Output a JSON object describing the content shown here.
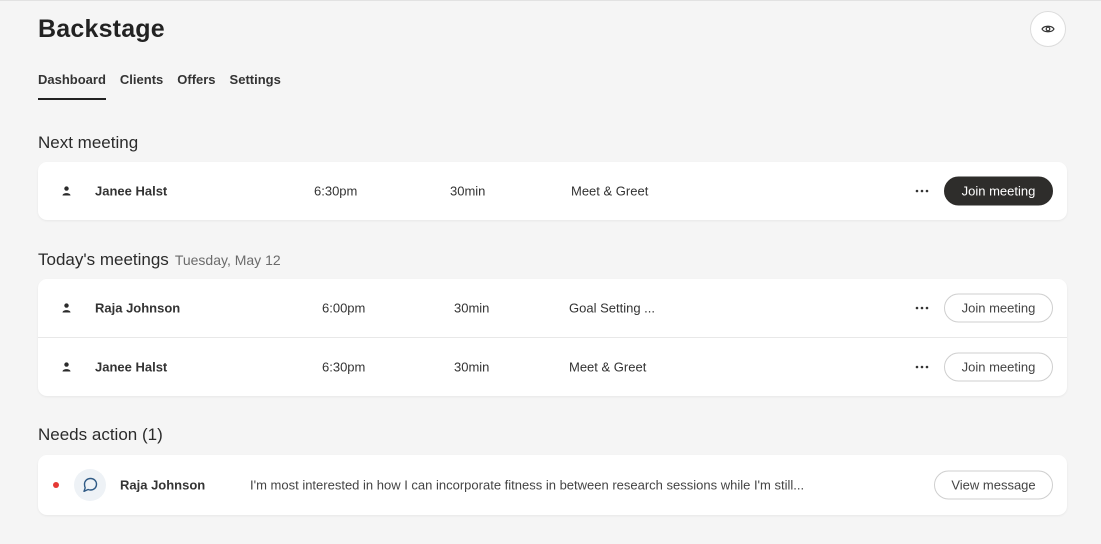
{
  "app": {
    "title": "Backstage"
  },
  "icons": {
    "eye": "eye-icon",
    "person": "person-icon",
    "more": "more-horizontal-icon",
    "chat": "chat-bubble-icon"
  },
  "colors": {
    "background": "#f5f5f5",
    "card": "#ffffff",
    "primary_button": "#2e2d2b",
    "unread_dot": "#e53935",
    "chat_avatar_bg": "#eef2f6",
    "chat_icon": "#2f5a85"
  },
  "tabs": [
    {
      "label": "Dashboard",
      "active": true
    },
    {
      "label": "Clients",
      "active": false
    },
    {
      "label": "Offers",
      "active": false
    },
    {
      "label": "Settings",
      "active": false
    }
  ],
  "next_meeting": {
    "title": "Next meeting",
    "name": "Janee Halst",
    "time": "6:30pm",
    "duration": "30min",
    "type": "Meet & Greet",
    "button": "Join meeting"
  },
  "today": {
    "title": "Today's meetings",
    "date": "Tuesday, May 12",
    "rows": [
      {
        "name": "Raja Johnson",
        "time": "6:00pm",
        "duration": "30min",
        "type": "Goal Setting ...",
        "button": "Join meeting"
      },
      {
        "name": "Janee Halst",
        "time": "6:30pm",
        "duration": "30min",
        "type": "Meet & Greet",
        "button": "Join meeting"
      }
    ]
  },
  "needs_action": {
    "title": "Needs action (1)",
    "name": "Raja Johnson",
    "message": "I'm most interested in how I can incorporate fitness in between research sessions while I'm still...",
    "button": "View message"
  }
}
